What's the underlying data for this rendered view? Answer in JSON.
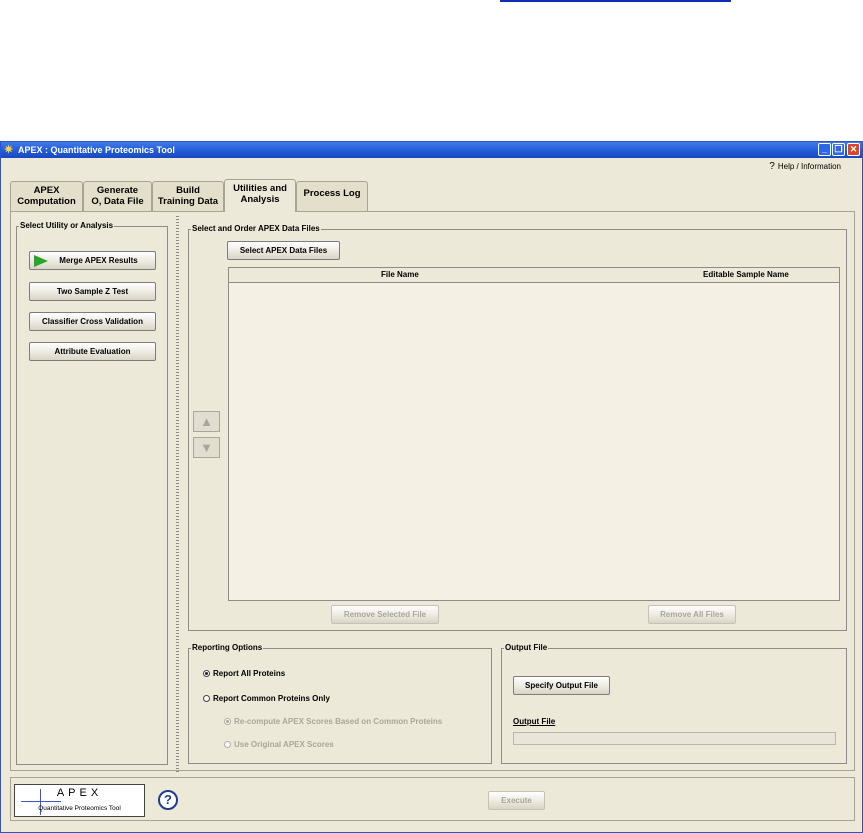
{
  "window": {
    "title": "APEX : Quantitative Proteomics Tool",
    "help_info": "Help / Information",
    "controls": [
      "_",
      "❐",
      "✕"
    ]
  },
  "tabs": [
    {
      "label": "APEX Computation",
      "line1": "APEX",
      "line2": "Computation"
    },
    {
      "label": "Generate Data File",
      "line1": "Generate",
      "line2": "O, Data File"
    },
    {
      "label": "Build Training Data",
      "line1": "Build",
      "line2": "Training Data"
    },
    {
      "label": "Utilities and Analysis",
      "line1": "Utilities and",
      "line2": "Analysis"
    },
    {
      "label": "Process Log",
      "line1": "Process Log",
      "line2": ""
    }
  ],
  "left_panel": {
    "legend": "Select Utility or Analysis",
    "buttons": [
      {
        "label": "Merge APEX Results",
        "selected": true
      },
      {
        "label": "Two Sample Z Test"
      },
      {
        "label": "Classifier Cross Validation"
      },
      {
        "label": "Attribute Evaluation"
      }
    ]
  },
  "files_panel": {
    "legend": "Select and Order APEX Data Files",
    "select_button": "Select APEX Data Files",
    "columns": [
      "File Name",
      "Editable Sample Name"
    ],
    "rows": [],
    "move_up": "▲",
    "move_down": "▼",
    "remove_selected": "Remove Selected File",
    "remove_all": "Remove All Files"
  },
  "reporting": {
    "legend": "Reporting Options",
    "options": [
      {
        "label": "Report All Proteins",
        "checked": true,
        "enabled": true
      },
      {
        "label": "Report Common Proteins Only",
        "checked": false,
        "enabled": true
      },
      {
        "label": "Re-compute APEX Scores Based on Common Proteins",
        "checked": true,
        "enabled": false
      },
      {
        "label": "Use Original APEX Scores",
        "checked": false,
        "enabled": false
      }
    ]
  },
  "output": {
    "legend": "Output File",
    "specify_button": "Specify Output File",
    "field_label": "Output File",
    "value": ""
  },
  "bottom": {
    "logo_title": "APEX",
    "logo_subtitle": "Quantitative Proteomics Tool",
    "help_symbol": "?",
    "execute": "Execute"
  },
  "colors": {
    "window_bg": "#ece9d8",
    "titlebar": "#2158d6",
    "accent_green": "#2aa52a"
  }
}
